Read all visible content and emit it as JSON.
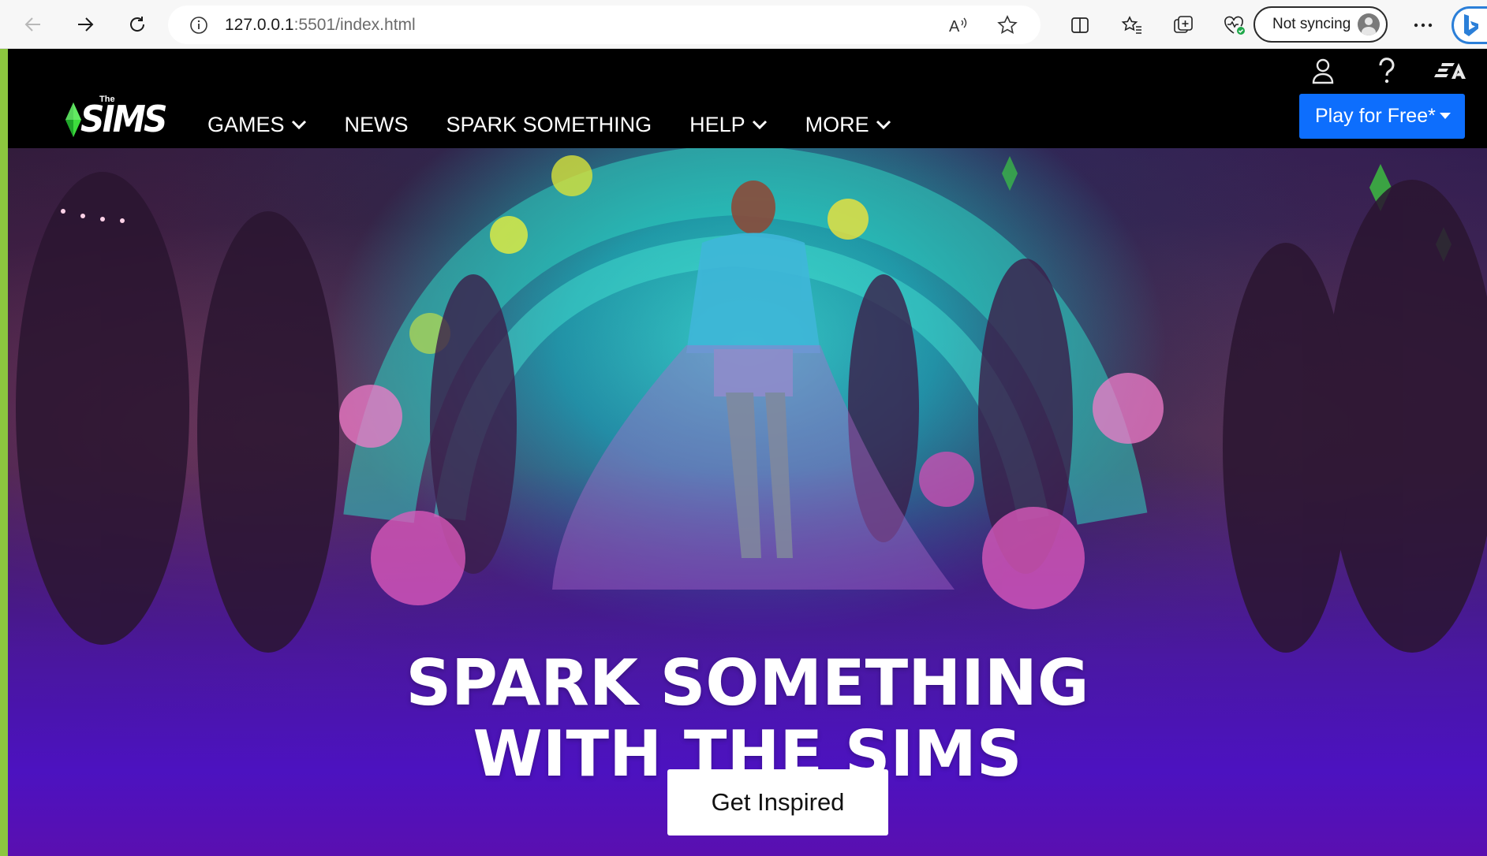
{
  "browser": {
    "url_host": "127.0.0.1",
    "url_rest": ":5501/index.html",
    "sync_label": "Not syncing",
    "icons": [
      "back-icon",
      "forward-icon",
      "refresh-icon",
      "info-icon",
      "read-aloud-icon",
      "favorite-star-icon",
      "split-screen-icon",
      "favorites-icon",
      "collections-icon",
      "browser-essentials-icon",
      "profile-avatar-icon",
      "more-icon",
      "bing-icon"
    ]
  },
  "header": {
    "logo_small": "The",
    "logo_word": "SIMS",
    "nav": [
      {
        "label": "GAMES",
        "dropdown": true
      },
      {
        "label": "NEWS",
        "dropdown": false
      },
      {
        "label": "SPARK SOMETHING",
        "dropdown": false
      },
      {
        "label": "HELP",
        "dropdown": true
      },
      {
        "label": "MORE",
        "dropdown": true
      }
    ],
    "play_label": "Play for Free*",
    "utility_icons": [
      "account-icon",
      "help-icon",
      "ea-logo-icon"
    ]
  },
  "hero": {
    "title_line1": "SPARK SOMETHING",
    "title_line2": "WITH THE SIMS",
    "cta_label": "Get Inspired"
  },
  "colors": {
    "accent_blue": "#0d6efd",
    "hero_purple": "#4c12c0",
    "strip_green": "#8cc63f",
    "plumbob_green": "#3ddc3d"
  }
}
